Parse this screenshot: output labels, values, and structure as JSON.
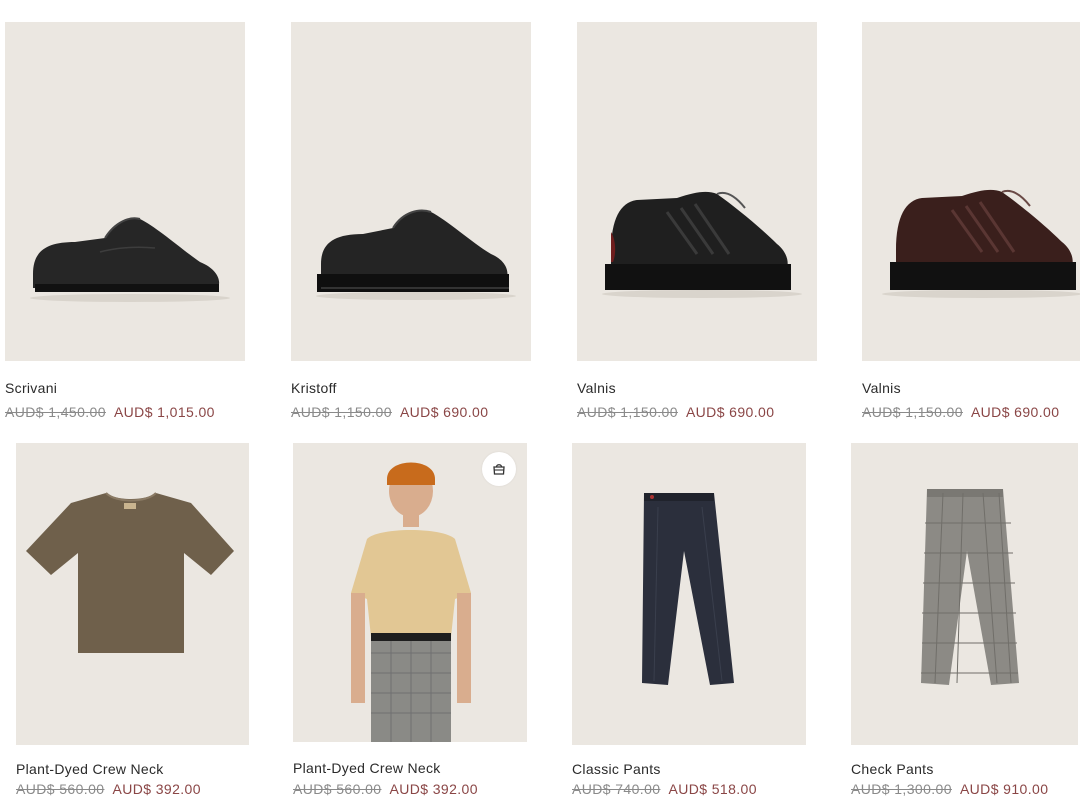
{
  "products": [
    {
      "name": "Scrivani",
      "old_price": "AUD$ 1,450.00",
      "price": "AUD$ 1,015.00",
      "image": "derby-shoe-black"
    },
    {
      "name": "Kristoff",
      "old_price": "AUD$ 1,150.00",
      "price": "AUD$ 690.00",
      "image": "derby-shoe-lug-sole"
    },
    {
      "name": "Valnis",
      "old_price": "AUD$ 1,150.00",
      "price": "AUD$ 690.00",
      "image": "sneaker-black"
    },
    {
      "name": "Valnis",
      "old_price": "AUD$ 1,150.00",
      "price": "AUD$ 690.00",
      "image": "sneaker-brown"
    },
    {
      "name": "Plant-Dyed Crew Neck",
      "old_price": "AUD$ 560.00",
      "price": "AUD$ 392.00",
      "image": "tshirt-khaki"
    },
    {
      "name": "Plant-Dyed Crew Neck",
      "old_price": "AUD$ 560.00",
      "price": "AUD$ 392.00",
      "image": "model-tshirt-beige"
    },
    {
      "name": "Classic Pants",
      "old_price": "AUD$ 740.00",
      "price": "AUD$ 518.00",
      "image": "pants-navy"
    },
    {
      "name": "Check Pants",
      "old_price": "AUD$ 1,300.00",
      "price": "AUD$ 910.00",
      "image": "pants-check-grey"
    }
  ],
  "quick_add_icon": "shopping-bag-icon",
  "colors": {
    "image_bg": "#ece8e2",
    "sale_price": "#8a4646",
    "old_price": "#8a8a8a"
  }
}
